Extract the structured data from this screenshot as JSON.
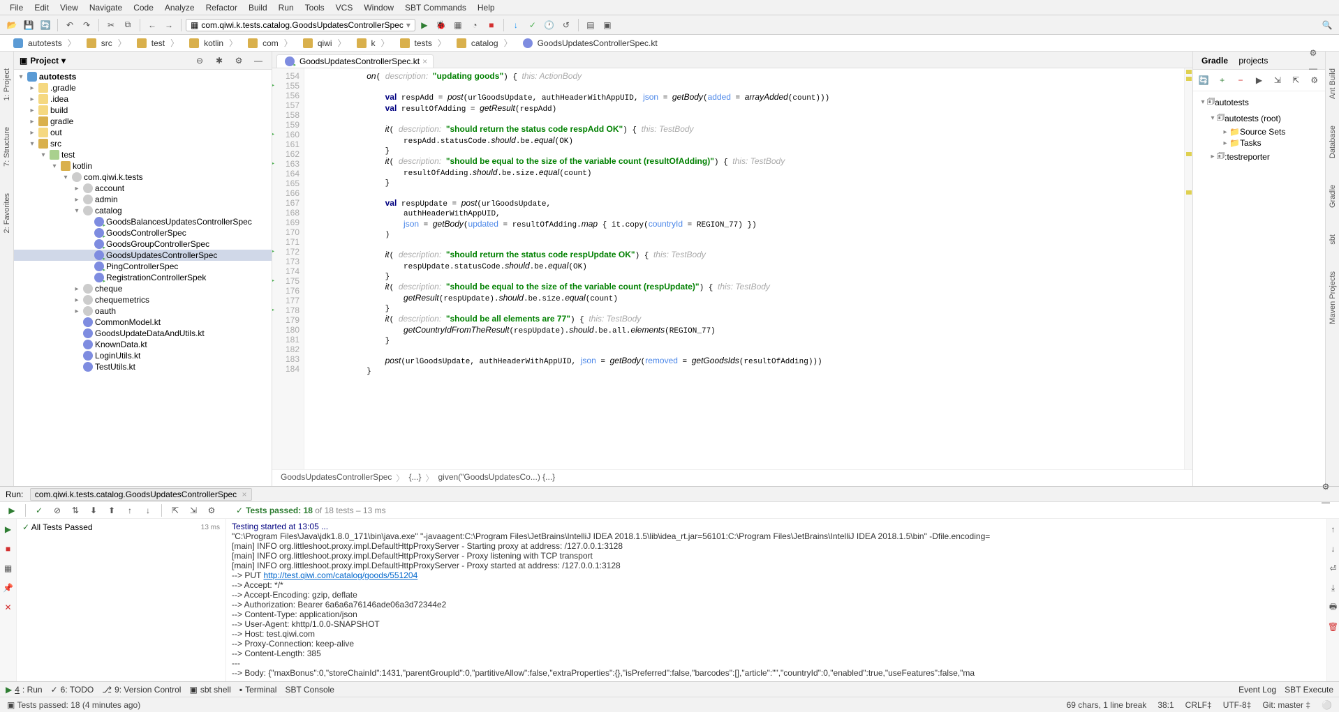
{
  "menu": [
    "File",
    "Edit",
    "View",
    "Navigate",
    "Code",
    "Analyze",
    "Refactor",
    "Build",
    "Run",
    "Tools",
    "VCS",
    "Window",
    "SBT Commands",
    "Help"
  ],
  "runconfig": "com.qiwi.k.tests.catalog.GoodsUpdatesControllerSpec",
  "breadcrumb": [
    "autotests",
    "src",
    "test",
    "kotlin",
    "com",
    "qiwi",
    "k",
    "tests",
    "catalog",
    "GoodsUpdatesControllerSpec.kt"
  ],
  "project": {
    "title": "Project",
    "root": "autotests",
    "items": [
      {
        "name": ".gradle",
        "ic": "ic-folder-y",
        "ind": 1,
        "tw": "▸"
      },
      {
        "name": ".idea",
        "ic": "ic-folder-y",
        "ind": 1,
        "tw": "▸"
      },
      {
        "name": "build",
        "ic": "ic-folder-y",
        "ind": 1,
        "tw": "▸"
      },
      {
        "name": "gradle",
        "ic": "ic-folder",
        "ind": 1,
        "tw": "▸"
      },
      {
        "name": "out",
        "ic": "ic-folder-y",
        "ind": 1,
        "tw": "▸"
      },
      {
        "name": "src",
        "ic": "ic-folder",
        "ind": 1,
        "tw": "▾"
      },
      {
        "name": "test",
        "ic": "ic-folder-g",
        "ind": 2,
        "tw": "▾"
      },
      {
        "name": "kotlin",
        "ic": "ic-folder",
        "ind": 3,
        "tw": "▾"
      },
      {
        "name": "com.qiwi.k.tests",
        "ic": "ic-pkg",
        "ind": 4,
        "tw": "▾"
      },
      {
        "name": "account",
        "ic": "ic-pkg",
        "ind": 5,
        "tw": "▸"
      },
      {
        "name": "admin",
        "ic": "ic-pkg",
        "ind": 5,
        "tw": "▸"
      },
      {
        "name": "catalog",
        "ic": "ic-pkg",
        "ind": 5,
        "tw": "▾"
      },
      {
        "name": "GoodsBalancesUpdatesControllerSpec",
        "ic": "ic-kt-run",
        "ind": 6,
        "tw": ""
      },
      {
        "name": "GoodsControllerSpec",
        "ic": "ic-kt-run",
        "ind": 6,
        "tw": ""
      },
      {
        "name": "GoodsGroupControllerSpec",
        "ic": "ic-kt-run",
        "ind": 6,
        "tw": ""
      },
      {
        "name": "GoodsUpdatesControllerSpec",
        "ic": "ic-kt-run",
        "ind": 6,
        "tw": "",
        "sel": true
      },
      {
        "name": "PingControllerSpec",
        "ic": "ic-kt-run",
        "ind": 6,
        "tw": ""
      },
      {
        "name": "RegistrationControllerSpek",
        "ic": "ic-kt-run",
        "ind": 6,
        "tw": ""
      },
      {
        "name": "cheque",
        "ic": "ic-pkg",
        "ind": 5,
        "tw": "▸"
      },
      {
        "name": "chequemetrics",
        "ic": "ic-pkg",
        "ind": 5,
        "tw": "▸"
      },
      {
        "name": "oauth",
        "ic": "ic-pkg",
        "ind": 5,
        "tw": "▸"
      },
      {
        "name": "CommonModel.kt",
        "ic": "ic-kt",
        "ind": 5,
        "tw": ""
      },
      {
        "name": "GoodsUpdateDataAndUtils.kt",
        "ic": "ic-kt",
        "ind": 5,
        "tw": ""
      },
      {
        "name": "KnownData.kt",
        "ic": "ic-kt",
        "ind": 5,
        "tw": ""
      },
      {
        "name": "LoginUtils.kt",
        "ic": "ic-kt",
        "ind": 5,
        "tw": ""
      },
      {
        "name": "TestUtils.kt",
        "ic": "ic-kt",
        "ind": 5,
        "tw": ""
      }
    ]
  },
  "tab": "GoodsUpdatesControllerSpec.kt",
  "lineStart": 154,
  "lineEnd": 184,
  "runLines": [
    155,
    160,
    163,
    172,
    175,
    178
  ],
  "editorCrumb": [
    "GoodsUpdatesControllerSpec",
    "{...}",
    "given(\"GoodsUpdatesCo...) {...}"
  ],
  "gradle": {
    "tabs": [
      "Gradle",
      "projects"
    ],
    "root": "autotests",
    "child": "autotests (root)",
    "leaves": [
      "Source Sets",
      "Tasks",
      ":testreporter"
    ]
  },
  "run": {
    "label": "Run:",
    "conf": "com.qiwi.k.tests.catalog.GoodsUpdatesControllerSpec",
    "status_pre": "Tests passed: 18",
    "status_post": " of 18 tests – 13 ms",
    "tree": "All Tests Passed",
    "tree_time": "13 ms",
    "out": [
      {
        "t": "Testing started at 13:05 ...",
        "cls": "navy"
      },
      {
        "t": "\"C:\\Program Files\\Java\\jdk1.8.0_171\\bin\\java.exe\" \"-javaagent:C:\\Program Files\\JetBrains\\IntelliJ IDEA 2018.1.5\\lib\\idea_rt.jar=56101:C:\\Program Files\\JetBrains\\IntelliJ IDEA 2018.1.5\\bin\" -Dfile.encoding="
      },
      {
        "t": "[main] INFO org.littleshoot.proxy.impl.DefaultHttpProxyServer - Starting proxy at address: /127.0.0.1:3128"
      },
      {
        "t": "[main] INFO org.littleshoot.proxy.impl.DefaultHttpProxyServer - Proxy listening with TCP transport"
      },
      {
        "t": "[main] INFO org.littleshoot.proxy.impl.DefaultHttpProxyServer - Proxy started at address: /127.0.0.1:3128"
      },
      {
        "pre": "--> PUT ",
        "link": "http://test.qiwi.com/catalog/goods/551204"
      },
      {
        "t": "--> Accept: */*"
      },
      {
        "t": "--> Accept-Encoding: gzip, deflate"
      },
      {
        "t": "--> Authorization: Bearer 6a6a6a76146ade06a3d72344e2"
      },
      {
        "t": "--> Content-Type: application/json"
      },
      {
        "t": "--> User-Agent: khttp/1.0.0-SNAPSHOT"
      },
      {
        "t": "--> Host: test.qiwi.com"
      },
      {
        "t": "--> Proxy-Connection: keep-alive"
      },
      {
        "t": "--> Content-Length: 385"
      },
      {
        "t": "---"
      },
      {
        "t": "--> Body: {\"maxBonus\":0,\"storeChainId\":1431,\"parentGroupId\":0,\"partitiveAllow\":false,\"extraProperties\":{},\"isPreferred\":false,\"barcodes\":[],\"article\":\"\",\"countryId\":0,\"enabled\":true,\"useFeatures\":false,\"ma"
      },
      {
        "t": "---"
      }
    ]
  },
  "bottomTabs": [
    {
      "ic": "▶",
      "lbl": "4: Run"
    },
    {
      "ic": "✓",
      "lbl": "6: TODO"
    },
    {
      "ic": "⎇",
      "lbl": "9: Version Control"
    },
    {
      "ic": "▣",
      "lbl": "sbt shell"
    },
    {
      "ic": "▪",
      "lbl": "Terminal"
    },
    {
      "ic": "",
      "lbl": "SBT Console"
    }
  ],
  "bottomRight": [
    "Event Log",
    "SBT Execute"
  ],
  "status": {
    "msg": "Tests passed: 18 (4 minutes ago)",
    "right": [
      "69 chars, 1 line break",
      "38:1",
      "CRLF‡",
      "UTF-8‡",
      "Git: master ‡",
      "⚪"
    ]
  },
  "leftTabs": [
    "1: Project",
    "7: Structure",
    "2: Favorites"
  ],
  "rightTabs": [
    "Ant Build",
    "Database",
    "Gradle",
    "sbt",
    "Maven Projects"
  ]
}
